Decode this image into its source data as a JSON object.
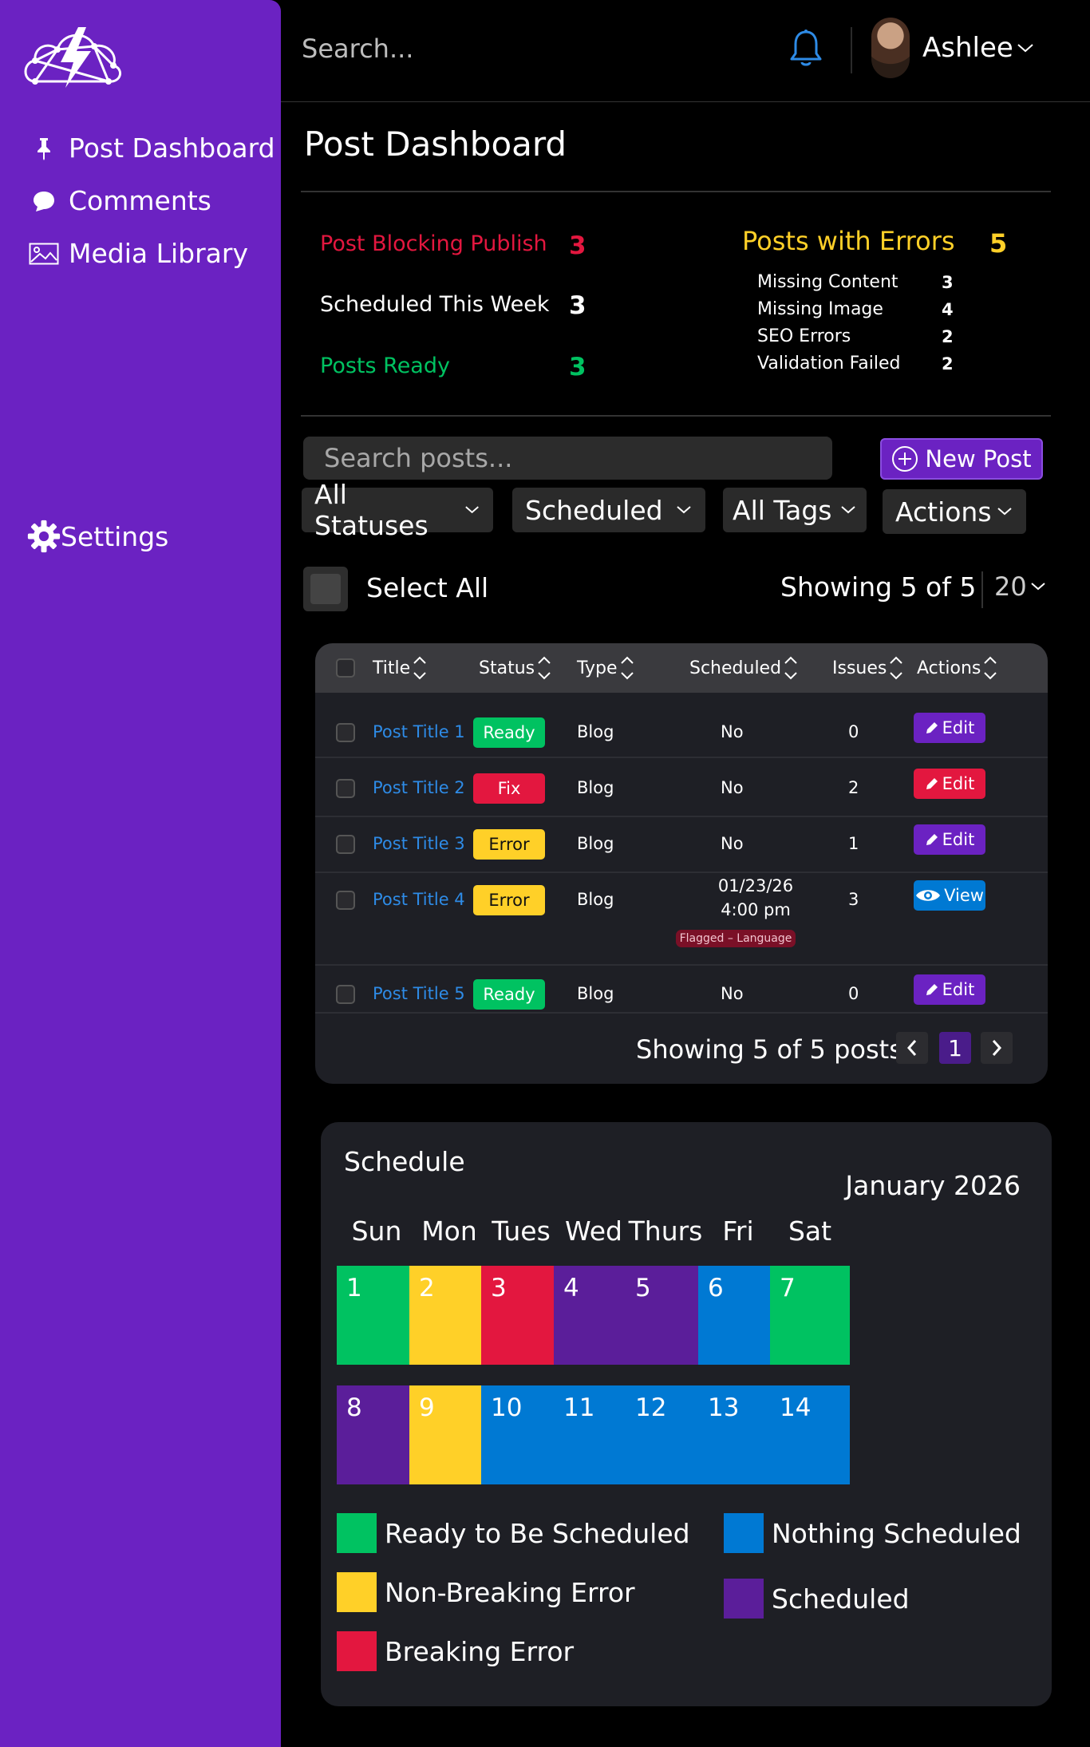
{
  "colors": {
    "sidebar": "#6b22c2",
    "ready": "#00c261",
    "fix": "#e3173f",
    "error": "#ffd028",
    "purple": "#5b1e9a",
    "blue": "#0079d3",
    "accent": "#6b22c2"
  },
  "sidebar": {
    "items": [
      {
        "label": "Post Dashboard",
        "icon": "pin-icon"
      },
      {
        "label": "Comments",
        "icon": "comment-icon"
      },
      {
        "label": "Media Library",
        "icon": "image-icon"
      }
    ],
    "settings_label": "Settings"
  },
  "header": {
    "search_placeholder": "Search...",
    "username": "Ashlee"
  },
  "page": {
    "title": "Post Dashboard"
  },
  "stats": {
    "blocking": {
      "label": "Post Blocking Publish",
      "value": "3"
    },
    "scheduled": {
      "label": "Scheduled This Week",
      "value": "3"
    },
    "ready": {
      "label": "Posts Ready",
      "value": "3"
    },
    "errors": {
      "label": "Posts with Errors",
      "value": "5",
      "items": [
        {
          "label": "Missing Content",
          "value": "3"
        },
        {
          "label": "Missing Image",
          "value": "4"
        },
        {
          "label": "SEO Errors",
          "value": "2"
        },
        {
          "label": "Validation Failed",
          "value": "2"
        }
      ]
    }
  },
  "toolbar": {
    "search_placeholder": "Search posts...",
    "new_post_label": "New Post",
    "filters": [
      "All Statuses",
      "Scheduled",
      "All Tags",
      "Actions"
    ],
    "select_all_label": "Select All",
    "showing": "Showing 5 of 5",
    "per_page": "20"
  },
  "table": {
    "headers": [
      "Title",
      "Status",
      "Type",
      "Scheduled",
      "Issues",
      "Actions"
    ],
    "rows": [
      {
        "title": "Post Title 1",
        "status": "Ready",
        "status_kind": "ready",
        "type": "Blog",
        "scheduled": "No",
        "issues": "0",
        "action": "Edit",
        "action_kind": "edit"
      },
      {
        "title": "Post Title 2",
        "status": "Fix",
        "status_kind": "fix",
        "type": "Blog",
        "scheduled": "No",
        "issues": "2",
        "action": "Edit",
        "action_kind": "edit-red"
      },
      {
        "title": "Post Title 3",
        "status": "Error",
        "status_kind": "error",
        "type": "Blog",
        "scheduled": "No",
        "issues": "1",
        "action": "Edit",
        "action_kind": "edit"
      },
      {
        "title": "Post Title 4",
        "status": "Error",
        "status_kind": "error",
        "type": "Blog",
        "scheduled_line1": "01/23/26",
        "scheduled_line2": "4:00 pm",
        "flag": "Flagged – Language",
        "issues": "3",
        "action": "View",
        "action_kind": "view"
      },
      {
        "title": "Post Title 5",
        "status": "Ready",
        "status_kind": "ready",
        "type": "Blog",
        "scheduled": "No",
        "issues": "0",
        "action": "Edit",
        "action_kind": "edit"
      }
    ],
    "footer_showing": "Showing 5 of 5 posts",
    "current_page": "1"
  },
  "schedule": {
    "title": "Schedule",
    "month": "January 2026",
    "weekdays": [
      "Sun",
      "Mon",
      "Tues",
      "Wed",
      "Thurs",
      "Fri",
      "Sat"
    ],
    "days": [
      {
        "n": "1",
        "kind": "ready"
      },
      {
        "n": "2",
        "kind": "error"
      },
      {
        "n": "3",
        "kind": "fix"
      },
      {
        "n": "4",
        "kind": "purple"
      },
      {
        "n": "5",
        "kind": "purple"
      },
      {
        "n": "6",
        "kind": "blue"
      },
      {
        "n": "7",
        "kind": "ready"
      },
      {
        "n": "8",
        "kind": "purple"
      },
      {
        "n": "9",
        "kind": "error"
      },
      {
        "n": "10",
        "kind": "blue"
      },
      {
        "n": "11",
        "kind": "blue"
      },
      {
        "n": "12",
        "kind": "blue"
      },
      {
        "n": "13",
        "kind": "blue"
      },
      {
        "n": "14",
        "kind": "blue"
      }
    ],
    "legend": [
      {
        "label": "Ready to Be Scheduled",
        "kind": "ready"
      },
      {
        "label": "Non-Breaking Error",
        "kind": "error"
      },
      {
        "label": "Breaking Error",
        "kind": "fix"
      },
      {
        "label": "Nothing Scheduled",
        "kind": "blue"
      },
      {
        "label": "Scheduled",
        "kind": "purple"
      }
    ]
  }
}
